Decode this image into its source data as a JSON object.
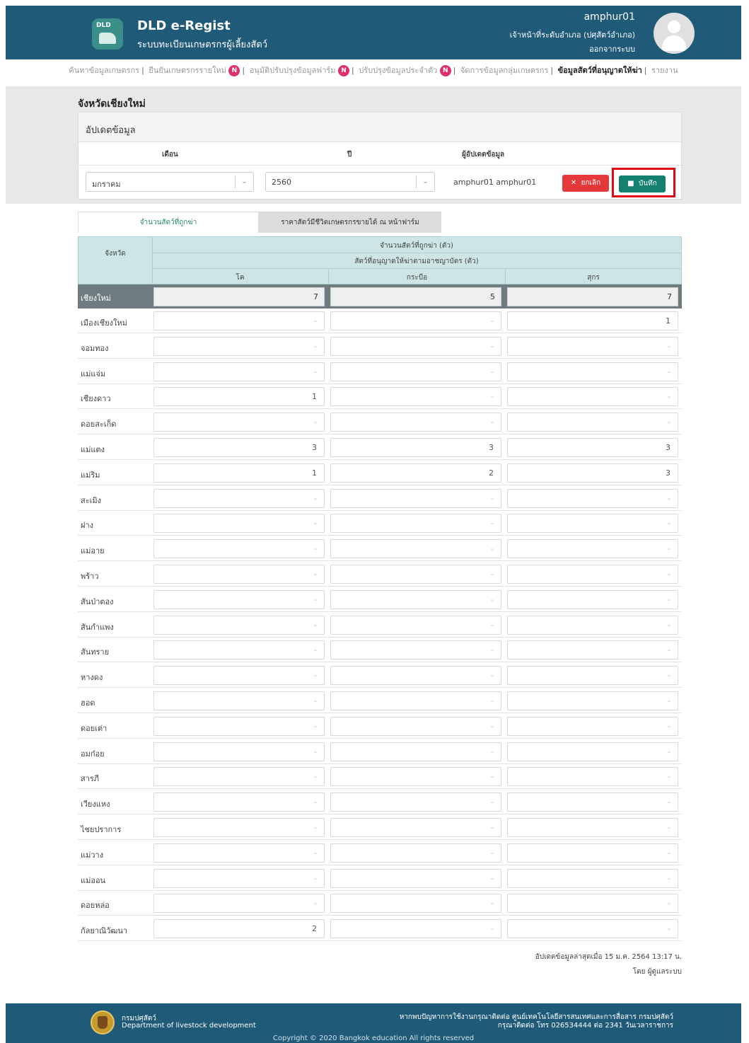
{
  "header": {
    "logo_text": "DLD",
    "title": "DLD e-Regist",
    "subtitle": "ระบบทะเบียนเกษตรกรผู้เลี้ยงสัตว์",
    "username": "amphur01",
    "role": "เจ้าหน้าที่ระดับอำเภอ (ปศุสัตว์อำเภอ)",
    "logout": "ออกจากระบบ"
  },
  "nav": {
    "items": [
      {
        "label": "ค้นหาข้อมูลเกษตรกร",
        "badge": ""
      },
      {
        "label": "ยืนยันเกษตรกรรายใหม่",
        "badge": "N"
      },
      {
        "label": "อนุมัติปรับปรุงข้อมูลฟาร์ม",
        "badge": "N"
      },
      {
        "label": "ปรับปรุงข้อมูลประจำตัว",
        "badge": "N"
      },
      {
        "label": "จัดการข้อมูลกลุ่มเกษตรกร",
        "badge": ""
      },
      {
        "label": "ข้อมูลสัตว์ที่อนุญาตให้ฆ่า",
        "badge": "",
        "active": true
      },
      {
        "label": "รายงาน",
        "badge": ""
      }
    ],
    "separator": "|"
  },
  "page": {
    "province_title": "จังหวัดเชียงใหม่",
    "panel_title": "อัปเดตข้อมูล",
    "col_month": "เดือน",
    "col_year": "ปี",
    "col_updater": "ผู้อัปเดตข้อมูล",
    "month_value": "มกราคม",
    "year_value": "2560",
    "updater_value": "amphur01 amphur01",
    "cancel_label": "ยกเลิก",
    "save_label": "บันทึก"
  },
  "tabs": [
    {
      "label": "จำนวนสัตว์ที่ถูกฆ่า",
      "active": true
    },
    {
      "label": "ราคาสัตว์มีชีวิตเกษตรกรขายได้ ณ หน้าฟาร์ม",
      "active": false
    }
  ],
  "table": {
    "col_province": "จังหวัด",
    "group_header": "จำนวนสัตว์ที่ถูกฆ่า (ตัว)",
    "sub_header": "สัตว์ที่อนุญาตให้ฆ่าตามอาชญาบัตร (ตัว)",
    "animals": [
      "โค",
      "กระบือ",
      "สุกร"
    ],
    "total": {
      "name": "เชียงใหม่",
      "values": [
        "7",
        "5",
        "7"
      ]
    },
    "rows": [
      {
        "name": "เมืองเชียงใหม่",
        "values": [
          "-",
          "-",
          "1"
        ]
      },
      {
        "name": "จอมทอง",
        "values": [
          "-",
          "-",
          "-"
        ]
      },
      {
        "name": "แม่แจ่ม",
        "values": [
          "-",
          "-",
          "-"
        ]
      },
      {
        "name": "เชียงดาว",
        "values": [
          "1",
          "-",
          "-"
        ]
      },
      {
        "name": "ดอยสะเก็ด",
        "values": [
          "-",
          "-",
          "-"
        ]
      },
      {
        "name": "แม่แตง",
        "values": [
          "3",
          "3",
          "3"
        ]
      },
      {
        "name": "แม่ริม",
        "values": [
          "1",
          "2",
          "3"
        ]
      },
      {
        "name": "สะเมิง",
        "values": [
          "-",
          "-",
          "-"
        ]
      },
      {
        "name": "ฝาง",
        "values": [
          "-",
          "-",
          "-"
        ]
      },
      {
        "name": "แม่อาย",
        "values": [
          "-",
          "-",
          "-"
        ]
      },
      {
        "name": "พร้าว",
        "values": [
          "-",
          "-",
          "-"
        ]
      },
      {
        "name": "สันป่าตอง",
        "values": [
          "-",
          "-",
          "-"
        ]
      },
      {
        "name": "สันกำแพง",
        "values": [
          "-",
          "-",
          "-"
        ]
      },
      {
        "name": "สันทราย",
        "values": [
          "-",
          "-",
          "-"
        ]
      },
      {
        "name": "หางดง",
        "values": [
          "-",
          "-",
          "-"
        ]
      },
      {
        "name": "ฮอด",
        "values": [
          "-",
          "-",
          "-"
        ]
      },
      {
        "name": "ดอยเต่า",
        "values": [
          "-",
          "-",
          "-"
        ]
      },
      {
        "name": "อมก๋อย",
        "values": [
          "-",
          "-",
          "-"
        ]
      },
      {
        "name": "สารภี",
        "values": [
          "-",
          "-",
          "-"
        ]
      },
      {
        "name": "เวียงแหง",
        "values": [
          "-",
          "-",
          "-"
        ]
      },
      {
        "name": "ไชยปราการ",
        "values": [
          "-",
          "-",
          "-"
        ]
      },
      {
        "name": "แม่วาง",
        "values": [
          "-",
          "-",
          "-"
        ]
      },
      {
        "name": "แม่ออน",
        "values": [
          "-",
          "-",
          "-"
        ]
      },
      {
        "name": "ดอยหล่อ",
        "values": [
          "-",
          "-",
          "-"
        ]
      },
      {
        "name": "กัลยาณิวัฒนา",
        "values": [
          "2",
          "-",
          "-"
        ]
      }
    ]
  },
  "meta": {
    "last_update": "อัปเดตข้อมูลล่าสุดเมื่อ 15 ม.ค. 2564 13:17 น.",
    "updated_by": "โดย ผู้ดูแลระบบ"
  },
  "footer": {
    "dept_th": "กรมปศุสัตว์",
    "dept_en": "Department of livestock development",
    "help1": "หากพบปัญหาการใช้งานกรุณาติดต่อ ศูนย์เทคโนโลยีสารสนเทศและการสื่อสาร กรมปศุสัตว์",
    "help2": "กรุณาติดต่อ โทร 026534444 ต่อ 2341 วันเวลาราชการ",
    "copyright": "Copyright © 2020 Bangkok education All rights reserved"
  },
  "colors": {
    "header_bg": "#1f5a78",
    "accent_green": "#14806f",
    "cancel_red": "#e5383b",
    "badge_pink": "#e0306a",
    "table_head": "#cde5e5",
    "total_row": "#6e7c80"
  }
}
